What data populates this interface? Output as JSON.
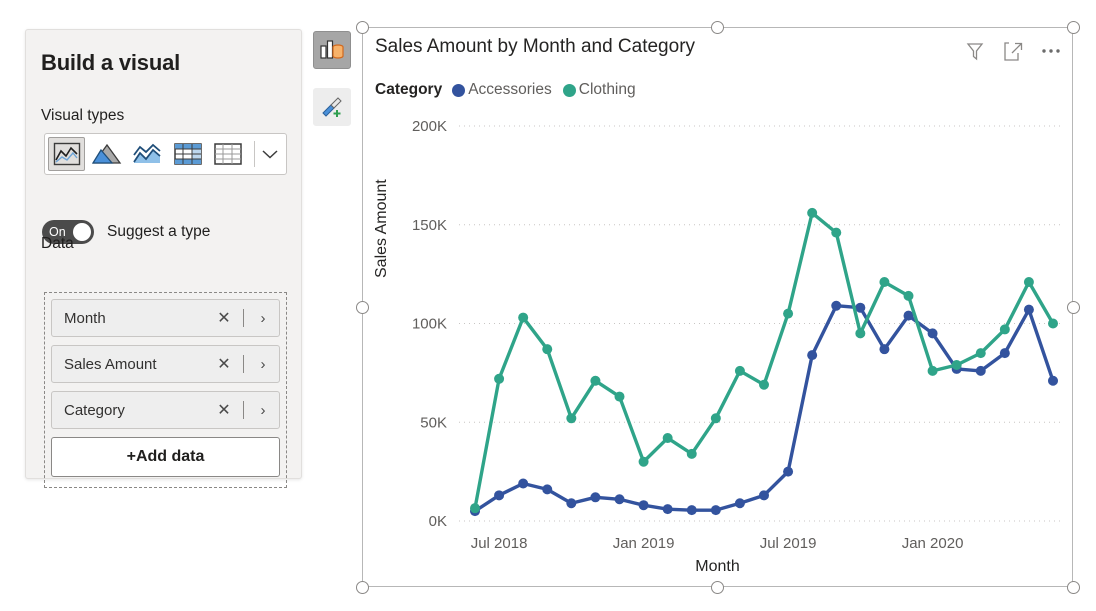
{
  "build_panel": {
    "title": "Build a visual",
    "visual_types_label": "Visual types",
    "data_label": "Data",
    "visual_types": [
      {
        "name": "line-chart-type",
        "selected": true
      },
      {
        "name": "area-chart-type",
        "selected": false
      },
      {
        "name": "line-and-area-chart-type",
        "selected": false
      },
      {
        "name": "matrix-type",
        "selected": false
      },
      {
        "name": "table-type",
        "selected": false
      }
    ],
    "chevron_icon": "chevron-down-icon",
    "suggest_toggle": {
      "state": "On",
      "label": "Suggest a type",
      "on": true
    },
    "fields": [
      {
        "label": "Month",
        "remove": "✕",
        "expand": "›"
      },
      {
        "label": "Sales Amount",
        "remove": "✕",
        "expand": "›"
      },
      {
        "label": "Category",
        "remove": "✕",
        "expand": "›"
      }
    ],
    "add_data_label": "+Add data"
  },
  "side_buttons": [
    {
      "name": "build-visual-button",
      "icon": "build-visual-icon",
      "active": true
    },
    {
      "name": "format-visual-button",
      "icon": "paintbrush-plus-icon",
      "active": false
    }
  ],
  "visual": {
    "title": "Sales Amount by Month and Category",
    "actions": [
      {
        "name": "filter-button",
        "icon": "funnel-icon"
      },
      {
        "name": "focus-mode-button",
        "icon": "expand-icon"
      },
      {
        "name": "more-options-button",
        "icon": "ellipsis-icon"
      }
    ],
    "legend": {
      "title": "Category",
      "items": [
        {
          "label": "Accessories",
          "color": "#33539E"
        },
        {
          "label": "Clothing",
          "color": "#2FA489"
        }
      ]
    }
  },
  "colors": {
    "accessories": "#33539E",
    "clothing": "#2FA489",
    "gridline": "#c8c6c4",
    "axis_text": "#605e5c",
    "title_text": "#252423",
    "panel_bg": "#f3f2f1",
    "visual_border": "#b7b7b7"
  },
  "chart_data": {
    "type": "line",
    "title": "Sales Amount by Month and Category",
    "xlabel": "Month",
    "ylabel": "Sales Amount",
    "ylim": [
      0,
      200000
    ],
    "yticks": [
      0,
      50000,
      100000,
      150000,
      200000
    ],
    "ytick_labels": [
      "0K",
      "50K",
      "100K",
      "150K",
      "200K"
    ],
    "grid": true,
    "legend_position": "top",
    "xtick_labels": [
      "Jul 2018",
      "Jan 2019",
      "Jul 2019",
      "Jan 2020"
    ],
    "xtick_indices": [
      1,
      7,
      13,
      19
    ],
    "x": [
      "Jun 2018",
      "Jul 2018",
      "Aug 2018",
      "Sep 2018",
      "Oct 2018",
      "Nov 2018",
      "Dec 2018",
      "Jan 2019",
      "Feb 2019",
      "Mar 2019",
      "Apr 2019",
      "May 2019",
      "Jun 2019",
      "Jul 2019",
      "Aug 2019",
      "Sep 2019",
      "Oct 2019",
      "Nov 2019",
      "Dec 2019",
      "Jan 2020",
      "Feb 2020",
      "Mar 2020",
      "Apr 2020",
      "May 2020",
      "Jun 2020"
    ],
    "series": [
      {
        "name": "Accessories",
        "color": "#33539E",
        "values": [
          5000,
          13000,
          19000,
          16000,
          9000,
          12000,
          11000,
          8000,
          6000,
          5500,
          5500,
          9000,
          13000,
          25000,
          84000,
          109000,
          108000,
          87000,
          104000,
          95000,
          77000,
          76000,
          85000,
          107000,
          71000
        ]
      },
      {
        "name": "Clothing",
        "color": "#2FA489",
        "values": [
          6500,
          72000,
          103000,
          87000,
          52000,
          71000,
          63000,
          30000,
          42000,
          34000,
          52000,
          76000,
          69000,
          105000,
          156000,
          146000,
          95000,
          121000,
          114000,
          76000,
          79000,
          85000,
          97000,
          121000,
          100000
        ]
      }
    ]
  }
}
